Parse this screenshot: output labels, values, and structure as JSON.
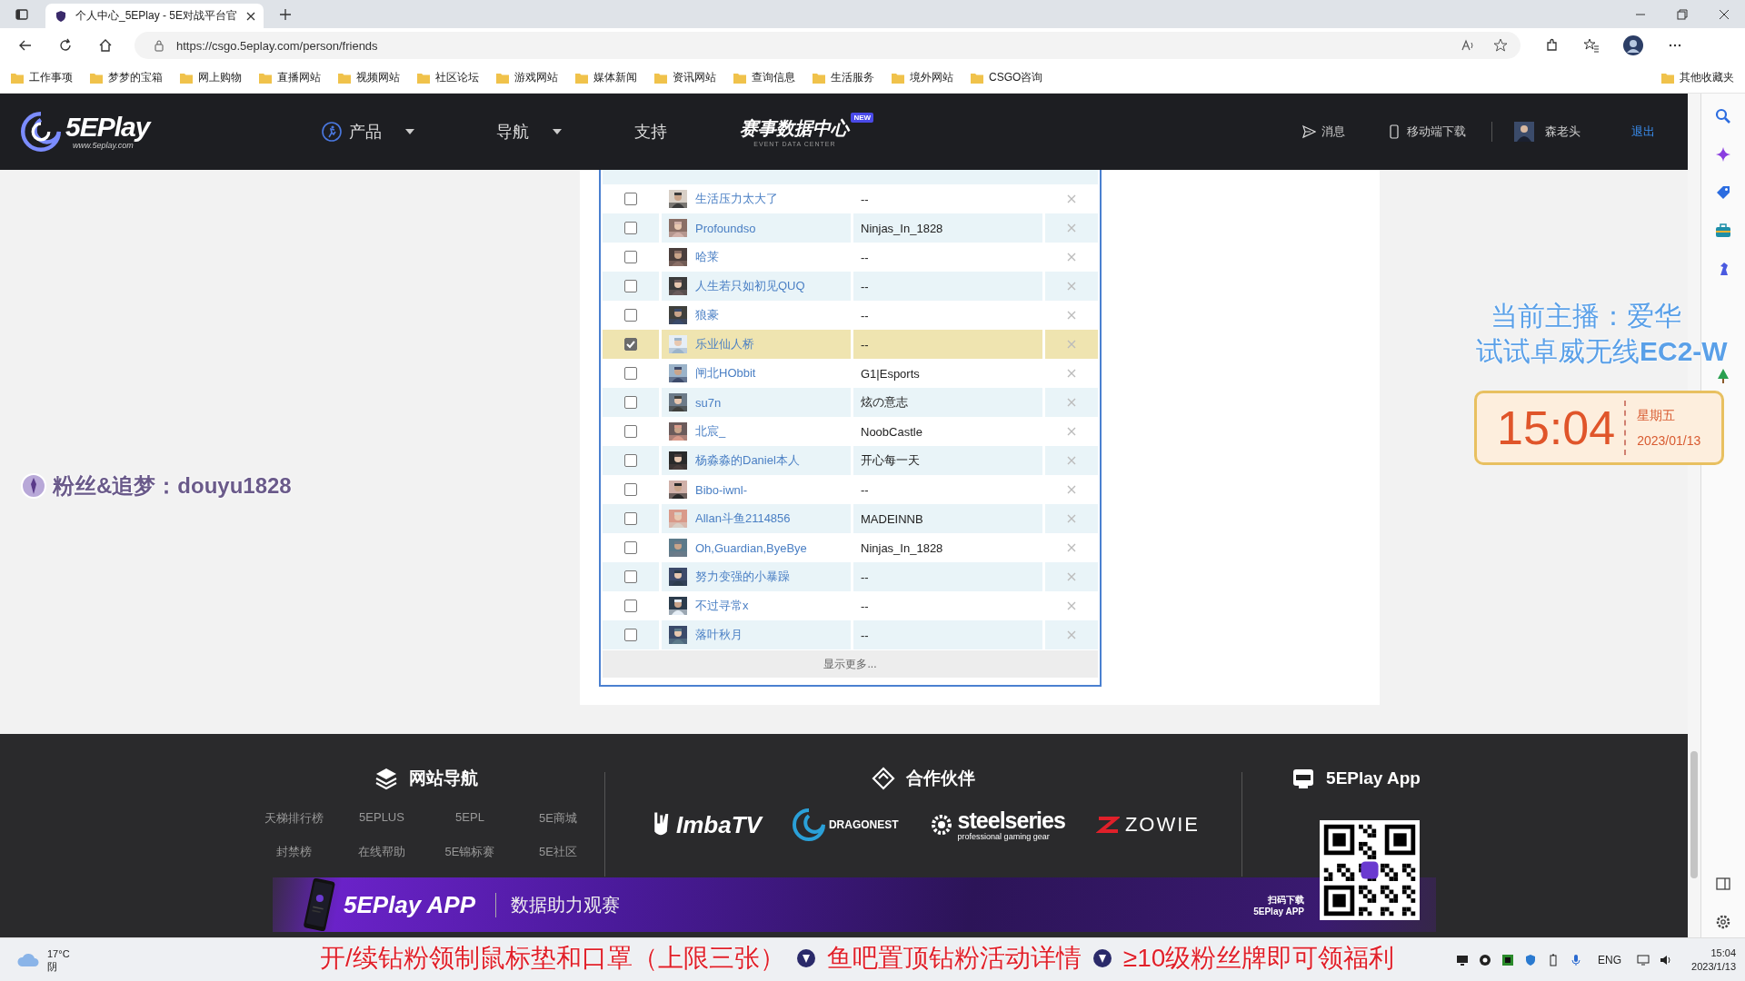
{
  "browser": {
    "tab_title": "个人中心_5EPlay - 5E对战平台官",
    "url": "https://csgo.5eplay.com/person/friends",
    "bookmarks": [
      "工作事项",
      "梦梦的宝箱",
      "网上购物",
      "直播网站",
      "视频网站",
      "社区论坛",
      "游戏网站",
      "媒体新闻",
      "资讯网站",
      "查询信息",
      "生活服务",
      "境外网站",
      "CSGO咨询"
    ],
    "other_bookmarks": "其他收藏夹"
  },
  "site_header": {
    "logo": "5EPlay",
    "logo_url": "www.5eplay.com",
    "nav": [
      {
        "label": "产品",
        "kind": "icon-menu"
      },
      {
        "label": "导航",
        "kind": "menu"
      },
      {
        "label": "支持",
        "kind": "link"
      },
      {
        "label": "赛事数据中心",
        "kind": "event",
        "sub": "EVENT DATA CENTER",
        "badge": "NEW"
      }
    ],
    "messages": "消息",
    "mobile": "移动端下载",
    "user": "森老头",
    "logout": "退出"
  },
  "friends": {
    "rows": [
      {
        "name": "生活压力太大了",
        "signature": "--",
        "selected": false
      },
      {
        "name": "Profoundso",
        "signature": "Ninjas_In_1828",
        "selected": false
      },
      {
        "name": "哈莱",
        "signature": "--",
        "selected": false
      },
      {
        "name": "人生若只如初见QUQ",
        "signature": "--",
        "selected": false
      },
      {
        "name": "狼豪",
        "signature": "--",
        "selected": false
      },
      {
        "name": "乐业仙人桥",
        "signature": "--",
        "selected": true
      },
      {
        "name": "闸北HObbit",
        "signature": "G1|Esports",
        "selected": false
      },
      {
        "name": "su7n",
        "signature": "炫の意志",
        "selected": false
      },
      {
        "name": "北宸_",
        "signature": "NoobCastle",
        "selected": false
      },
      {
        "name": "杨淼淼的Daniel本人",
        "signature": "开心每一天",
        "selected": false
      },
      {
        "name": "Bibo-iwnl-",
        "signature": "--",
        "selected": false
      },
      {
        "name": "Allan斗鱼2114856",
        "signature": "MADEINNB",
        "selected": false
      },
      {
        "name": "Oh,Guardian,ByeBye",
        "signature": "Ninjas_In_1828",
        "selected": false
      },
      {
        "name": "努力变强的小暴躁",
        "signature": "--",
        "selected": false
      },
      {
        "name": "不过寻常x",
        "signature": "--",
        "selected": false
      },
      {
        "name": "落叶秋月",
        "signature": "--",
        "selected": false
      }
    ],
    "more": "显示更多..."
  },
  "footer": {
    "nav_title": "网站导航",
    "nav_links": [
      "天梯排行榜",
      "5EPLUS",
      "5EPL",
      "5E商城",
      "封禁榜",
      "在线帮助",
      "5E锦标赛",
      "5E社区"
    ],
    "partners_title": "合作伙伴",
    "partners": [
      {
        "name": "ImbaTV",
        "kind": "imba"
      },
      {
        "name": "DRAGONEST",
        "kind": "dragonest"
      },
      {
        "name": "steelseries",
        "tagline": "professional gaming gear",
        "kind": "steelseries"
      },
      {
        "name": "ZOWIE",
        "kind": "zowie"
      }
    ],
    "app_title": "5EPlay App"
  },
  "banner": {
    "title": "5EPlay APP",
    "slogan": "数据助力观赛",
    "qr_caption": [
      "扫码下载",
      "5EPlay APP"
    ]
  },
  "overlay": {
    "fan_tag": "粉丝&追梦：douyu1828",
    "streamer": "当前主播：爱华",
    "ad_line": "试试卓威无线**EC2-W**",
    "clock": {
      "time": "15:04",
      "weekday": "星期五",
      "date": "2023/01/13"
    },
    "ticker": [
      "开/续钻粉领制鼠标垫和口罩（上限三张）",
      "鱼吧置顶钻粉活动详情",
      "≥10级粉丝牌即可领福利"
    ]
  },
  "taskbar": {
    "temperature": "17°C",
    "weather": "阴",
    "language": "ENG",
    "time": "15:04",
    "date": "2023/1/13"
  }
}
